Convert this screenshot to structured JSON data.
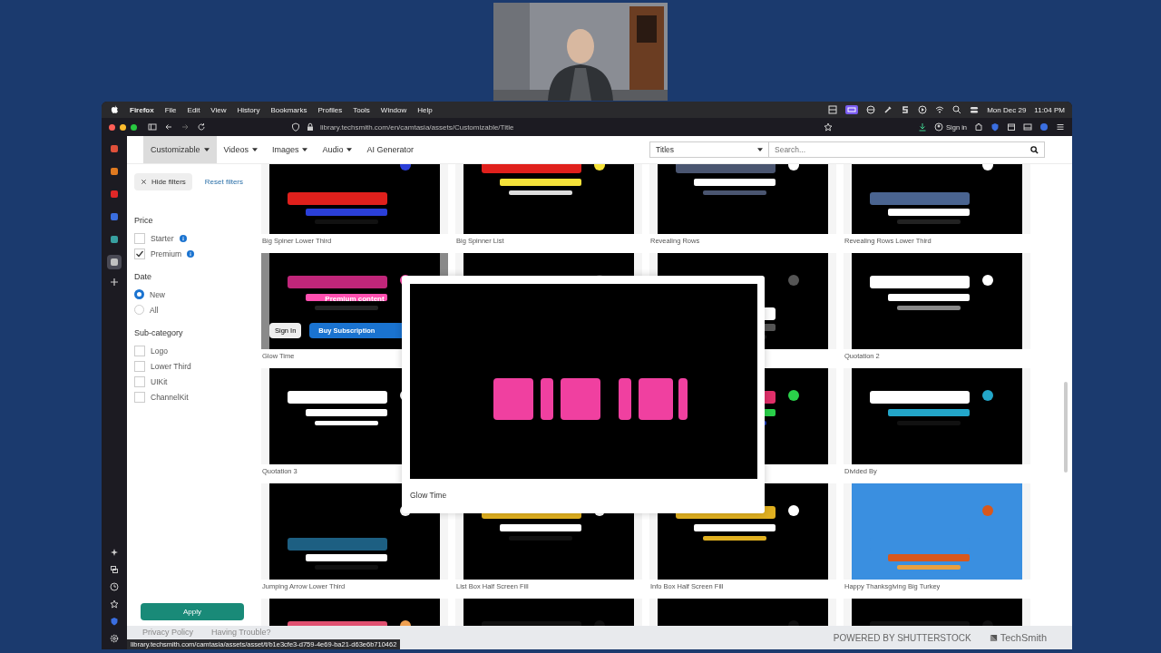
{
  "webcam": {
    "kind": "picture"
  },
  "menu_bar": {
    "app": "Firefox",
    "items": [
      "File",
      "Edit",
      "View",
      "History",
      "Bookmarks",
      "Profiles",
      "Tools",
      "Window",
      "Help"
    ],
    "date": "Mon Dec 29",
    "time": "11:04 PM"
  },
  "toolbar": {
    "url": "library.techsmith.com/en/camtasia/assets/Customizable/Title",
    "account": "Sign in"
  },
  "browser_sidebar": {
    "items": [
      {
        "selected": false
      },
      {
        "selected": false
      },
      {
        "selected": false
      },
      {
        "selected": false
      },
      {
        "selected": false
      },
      {
        "selected": true
      }
    ]
  },
  "nav": {
    "tabs": [
      {
        "label": "Customizable",
        "dropdown": true,
        "selected": true
      },
      {
        "label": "Videos",
        "dropdown": true,
        "selected": false
      },
      {
        "label": "Images",
        "dropdown": true,
        "selected": false
      },
      {
        "label": "Audio",
        "dropdown": true,
        "selected": false
      },
      {
        "label": "AI Generator",
        "dropdown": false,
        "selected": false
      }
    ],
    "category_select": {
      "value": "Titles"
    },
    "search": {
      "placeholder": "Search..."
    }
  },
  "filters": {
    "hide_button": "Hide filters",
    "reset_link": "Reset filters",
    "groups": [
      {
        "title": "Price",
        "kind": "checkbox",
        "options": [
          {
            "label": "Starter",
            "checked": false,
            "info": true
          },
          {
            "label": "Premium",
            "checked": true,
            "info": true
          }
        ]
      },
      {
        "title": "Date",
        "kind": "radio",
        "options": [
          {
            "label": "New",
            "selected": true
          },
          {
            "label": "All",
            "selected": false
          }
        ]
      },
      {
        "title": "Sub-category",
        "kind": "checkbox",
        "options": [
          {
            "label": "Logo",
            "checked": false
          },
          {
            "label": "Lower Third",
            "checked": false
          },
          {
            "label": "UIKit",
            "checked": false
          },
          {
            "label": "ChannelKit",
            "checked": false
          }
        ]
      }
    ],
    "apply_button": "Apply"
  },
  "grid": {
    "cards": [
      {
        "kind": "picture",
        "title": "Big Spiner Lower Third"
      },
      {
        "kind": "picture",
        "title": "Big Spinner List"
      },
      {
        "kind": "picture",
        "title": "Revealing Rows"
      },
      {
        "kind": "picture",
        "title": "Revealing Rows Lower Third"
      },
      {
        "kind": "picture",
        "title": "Glow Time",
        "hover": {
          "badge": "Premium content",
          "sign_in": "Sign In",
          "buy": "Buy Subscription"
        }
      },
      {
        "kind": "picture"
      },
      {
        "kind": "picture"
      },
      {
        "kind": "picture",
        "title": "Quotation 2"
      },
      {
        "kind": "picture",
        "title": "Quotation 3"
      },
      {
        "kind": "covered"
      },
      {
        "kind": "picture"
      },
      {
        "kind": "picture",
        "title": "Divided By"
      },
      {
        "kind": "picture",
        "title": "Jumping Arrow Lower Third"
      },
      {
        "kind": "picture",
        "title": "List Box Half Screen Fill"
      },
      {
        "kind": "picture",
        "title": "Info Box Half Screen Fill"
      },
      {
        "kind": "picture",
        "title": "Happy Thanksgiving Big Turkey"
      },
      {
        "kind": "picture"
      },
      {
        "kind": "picture"
      },
      {
        "kind": "picture"
      },
      {
        "kind": "picture"
      }
    ]
  },
  "preview_popup": {
    "title": "Glow Time"
  },
  "footer": {
    "links": [
      "Privacy Policy",
      "Having Trouble?"
    ],
    "powered_by": "POWERED BY SHUTTERSTOCK",
    "brand": "TechSmith"
  },
  "status_url": "library.techsmith.com/camtasia/assets/asset/t/b1e3cfe3-d759-4e69-ba21-d63e6b710462"
}
